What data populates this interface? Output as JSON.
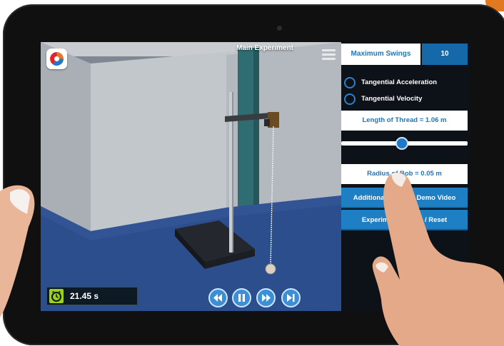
{
  "scene": {
    "title": "Main Experiment",
    "timer": "21.45 s"
  },
  "icons": {
    "logo": "brand-logo",
    "menu": "hamburger-icon",
    "timer": "alarm-clock-icon",
    "rewind": "rewind-icon",
    "pause": "pause-icon",
    "forward": "fast-forward-icon",
    "step": "step-forward-icon"
  },
  "panel": {
    "max_swings_label": "Maximum Swings",
    "max_swings_value": "10",
    "options": [
      {
        "label": "Tangential Acceleration",
        "selected": false
      },
      {
        "label": "Tangential Velocity",
        "selected": false
      }
    ],
    "length_label": "Length of Thread = 1.06 m",
    "length_slider_fraction": 0.48,
    "radius_label": "Radius of Bob = 0.05 m",
    "buttons": [
      {
        "label": "Additional Activity: Demo Video"
      },
      {
        "label": "Experiment Details / Reset"
      }
    ]
  },
  "colors": {
    "accent": "#1f7fc4",
    "panel_bg": "#0d1218",
    "timer_icon": "#9bd11b",
    "logo_orange": "#e8742a",
    "logo_blue": "#1f78c8",
    "logo_red": "#d9272e"
  }
}
